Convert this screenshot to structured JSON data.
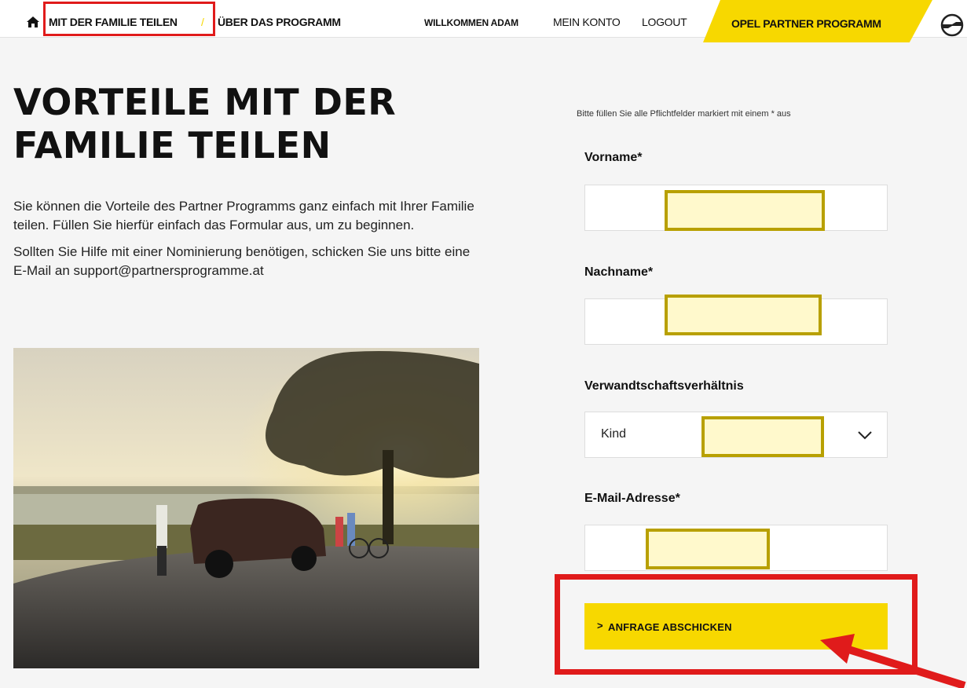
{
  "nav": {
    "crumb_family": "MIT DER FAMILIE TEILEN",
    "crumb_sep": "/",
    "crumb_program": "ÜBER DAS PROGRAMM",
    "welcome": "WILLKOMMEN ADAM",
    "account": "MEIN KONTO",
    "logout": "LOGOUT",
    "program_badge": "OPEL PARTNER PROGRAMM",
    "home_icon": "home-icon",
    "logo_icon": "opel-blitz-logo"
  },
  "page": {
    "headline_line1": "VORTEILE MIT DER",
    "headline_line2": "FAMILIE TEILEN",
    "intro_1": "Sie können die Vorteile des Partner Programms ganz einfach mit Ihrer Familie teilen. Füllen Sie hierfür einfach das Formular aus, um zu beginnen.",
    "intro_2": "Sollten Sie Hilfe mit einer Nominierung benötigen, schicken Sie uns bitte eine E-Mail an support@partnersprogramme.at"
  },
  "form": {
    "hint": "Bitte füllen Sie alle Pflichtfelder markiert mit einem * aus",
    "first_name_label": "Vorname*",
    "first_name_value": "",
    "last_name_label": "Nachname*",
    "last_name_value": "",
    "relation_label": "Verwandtschaftsverhältnis",
    "relation_value": "Kind",
    "email_label": "E-Mail-Adresse*",
    "email_value": "",
    "submit_caret": ">",
    "submit_label": "ANFRAGE ABSCHICKEN"
  },
  "colors": {
    "brand_yellow": "#f7d800",
    "annotation_red": "#e01b1b",
    "mask_fill": "#fff9cc",
    "mask_border": "#b8a000"
  }
}
